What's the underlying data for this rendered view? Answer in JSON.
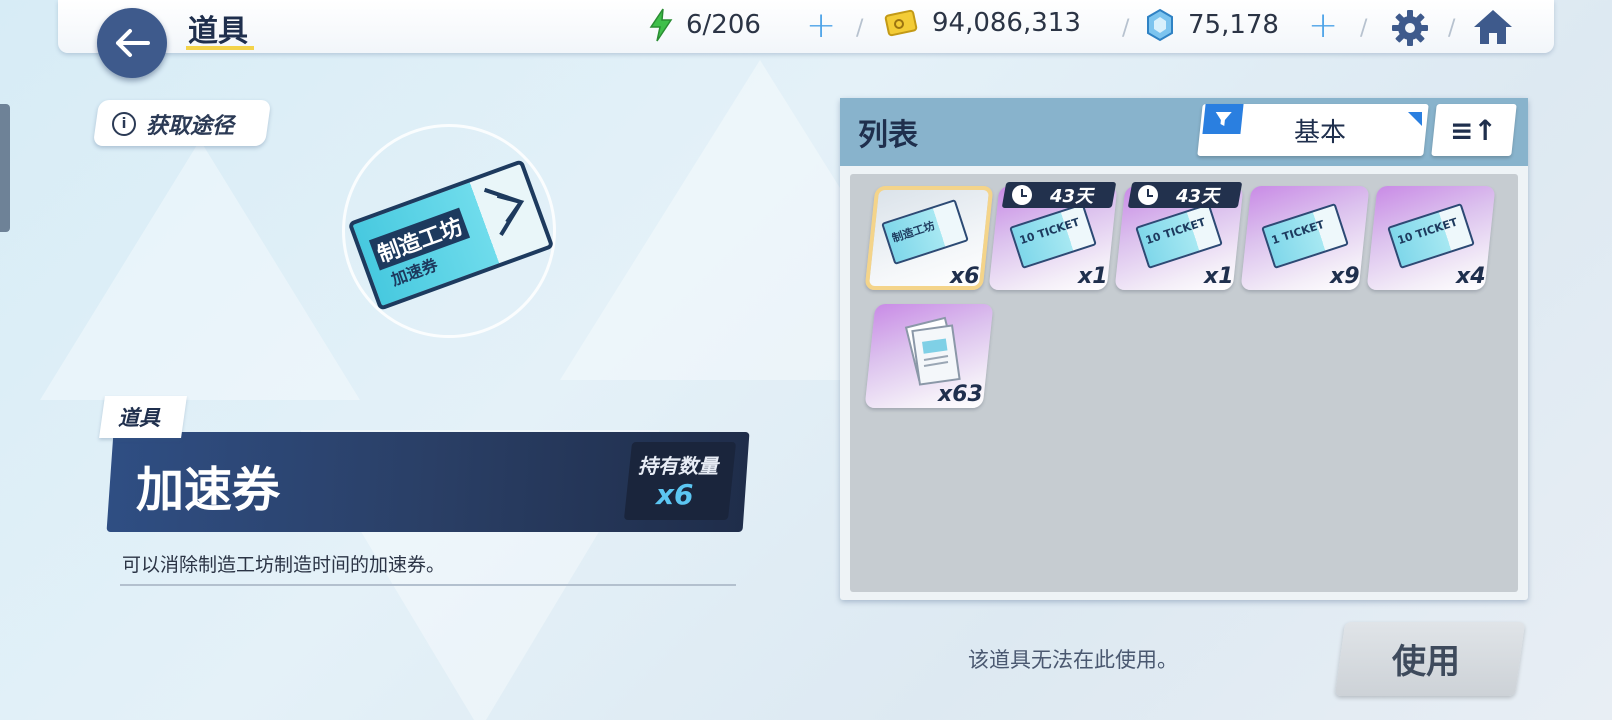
{
  "header": {
    "title": "道具",
    "stamina": "6/206",
    "gold": "94,086,313",
    "crystals": "75,178",
    "icons": [
      "back-arrow-icon",
      "lightning-icon",
      "gold-card-icon",
      "crystal-icon",
      "plus-icon",
      "gear-icon",
      "home-icon"
    ]
  },
  "detail": {
    "source_button": "获取途径",
    "info_icon": "i",
    "ticket_art_line1": "制造工坊",
    "ticket_art_line2": "加速券",
    "category": "道具",
    "name": "加速券",
    "qty_label": "持有数量",
    "qty_value": "x6",
    "description": "可以消除制造工坊制造时间的加速券。"
  },
  "list": {
    "title": "列表",
    "filter_label": "基本",
    "items": [
      {
        "count": "x6",
        "art": "speed-ticket",
        "ticket_text": "制造工坊",
        "timer": ""
      },
      {
        "count": "x1",
        "art": "10-ticket",
        "ticket_text": "10 TICKET",
        "timer": "43天"
      },
      {
        "count": "x1",
        "art": "10-ticket",
        "ticket_text": "10 TICKET",
        "timer": "43天"
      },
      {
        "count": "x9",
        "art": "1-ticket",
        "ticket_text": "1 TICKET",
        "timer": ""
      },
      {
        "count": "x4",
        "art": "10-ticket",
        "ticket_text": "10 TICKET",
        "timer": ""
      },
      {
        "count": "x63",
        "art": "document",
        "ticket_text": "",
        "timer": ""
      }
    ]
  },
  "footer": {
    "message": "该道具无法在此使用。",
    "use_button": "使用"
  },
  "colors": {
    "accent_blue": "#2a7fe0",
    "panel_dark": "#2a3f66",
    "qty_blue": "#5cc6f2",
    "title_underline": "#f3d34a"
  }
}
